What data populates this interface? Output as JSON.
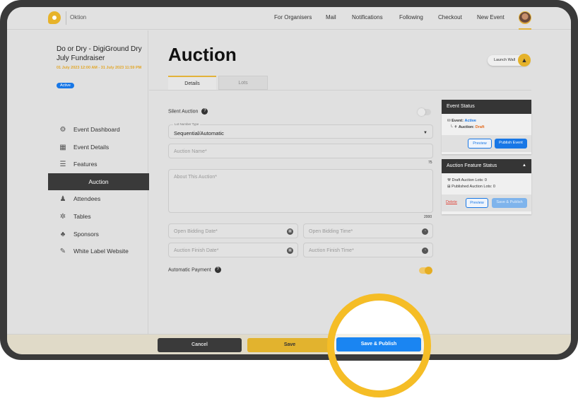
{
  "header": {
    "brand": "Oktion",
    "nav": [
      "For Organisers",
      "Mail",
      "Notifications",
      "Following",
      "Checkout",
      "New Event"
    ]
  },
  "event": {
    "title": "Do or Dry - DigiGround Dry July Fundraiser",
    "dates": "01 July 2023 12:00 AM - 31 July 2023 11:59 PM",
    "status": "Active"
  },
  "sidebar": {
    "items": [
      {
        "label": "Event Dashboard",
        "icon": "dashboard-icon"
      },
      {
        "label": "Event Details",
        "icon": "calendar-icon"
      },
      {
        "label": "Features",
        "icon": "sliders-icon"
      },
      {
        "label": "Auction",
        "icon": "",
        "active": true
      },
      {
        "label": "Attendees",
        "icon": "people-icon"
      },
      {
        "label": "Tables",
        "icon": "tables-icon"
      },
      {
        "label": "Sponsors",
        "icon": "sponsors-icon"
      },
      {
        "label": "White Label Website",
        "icon": "website-icon"
      }
    ]
  },
  "main": {
    "title": "Auction",
    "launch_wall": "Launch Wall",
    "tabs": [
      {
        "label": "Details",
        "active": true
      },
      {
        "label": "Lots"
      }
    ],
    "silent_auction_label": "Silent Auction",
    "silent_auction_on": false,
    "lot_number_type_label": "Lot Number Type",
    "lot_number_type_value": "Sequential/Automatic",
    "auction_name_placeholder": "Auction Name*",
    "auction_name_limit": "75",
    "about_placeholder": "About This Auction*",
    "about_limit": "2000",
    "open_date_placeholder": "Open Bidding Date*",
    "open_time_placeholder": "Open Bidding Time*",
    "finish_date_placeholder": "Auction Finish Date*",
    "finish_time_placeholder": "Auction Finish Time*",
    "automatic_payment_label": "Automatic Payment",
    "automatic_payment_on": true,
    "help_glyph": "?"
  },
  "event_status": {
    "title": "Event Status",
    "event_label": "Event:",
    "event_value": "Active",
    "auction_label": "Auction:",
    "auction_value": "Draft",
    "preview": "Preview",
    "publish": "Publish Event"
  },
  "auction_feature_status": {
    "title": "Auction Feature Status",
    "draft_lots": "Draft Auction Lots: 0",
    "published_lots": "Published Auction Lots: 0",
    "delete": "Delete",
    "preview": "Preview",
    "save_publish": "Save & Publish"
  },
  "footer": {
    "cancel": "Cancel",
    "save": "Save",
    "save_publish": "Save & Publish"
  },
  "colors": {
    "accent": "#e5b22a",
    "primary_blue": "#1877e6",
    "dark": "#3a3a3a",
    "highlight_ring": "#f5bd26"
  }
}
